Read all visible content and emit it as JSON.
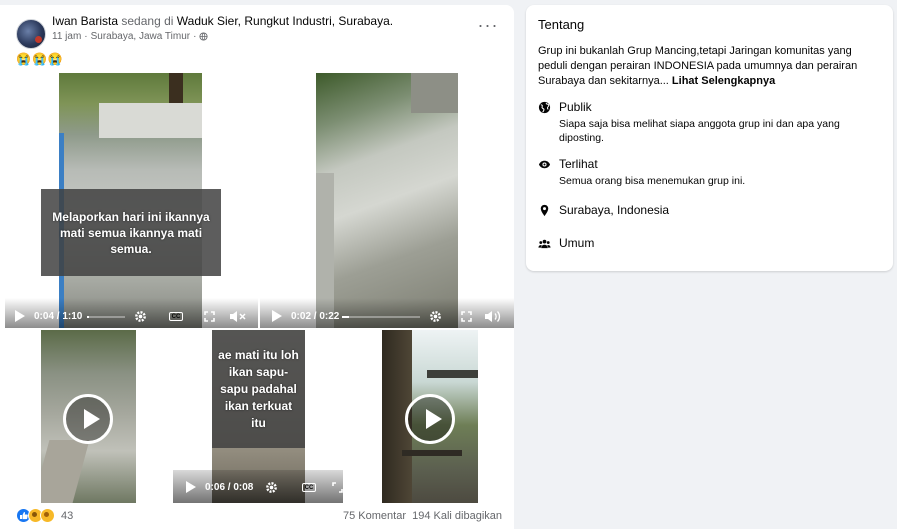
{
  "post": {
    "author": "Iwan Barista",
    "verb": "sedang di",
    "location": "Waduk Sier, Rungkut Industri, Surabaya.",
    "timestamp": "11 jam",
    "place": "Surabaya, Jawa Timur",
    "separator": "·",
    "emoji": "😭😭😭",
    "more_label": "···",
    "videos": [
      {
        "caption": "Melaporkan hari ini ikannya mati semua ikannya mati semua.",
        "time": "0:04 / 1:10",
        "progress": 0.06
      },
      {
        "time": "0:02 / 0:22",
        "progress": 0.09
      },
      {
        "caption": "ae mati itu loh ikan sapu-sapu padahal ikan terkuat itu",
        "time": "0:06 / 0:08",
        "progress": 0.75
      }
    ],
    "cc_label": "CC",
    "reaction_count": "43",
    "comments": "75 Komentar",
    "shares": "194 Kali dibagikan"
  },
  "about": {
    "title": "Tentang",
    "description": "Grup ini bukanlah Grup Mancing,tetapi Jaringan komunitas yang peduli dengan perairan INDONESIA pada umumnya dan perairan Surabaya dan sekitarnya...",
    "see_more": "Lihat Selengkapnya",
    "rows": [
      {
        "icon": "globe-icon",
        "label": "Publik",
        "sub": "Siapa saja bisa melihat siapa anggota grup ini dan apa yang diposting."
      },
      {
        "icon": "eye-icon",
        "label": "Terlihat",
        "sub": "Semua orang bisa menemukan grup ini."
      },
      {
        "icon": "location-pin-icon",
        "label": "Surabaya, Indonesia"
      },
      {
        "icon": "people-icon",
        "label": "Umum"
      }
    ]
  },
  "colors": {
    "background": "#f0f2f5",
    "card": "#ffffff",
    "muted_text": "#65676b",
    "like_blue": "#1877f2"
  }
}
